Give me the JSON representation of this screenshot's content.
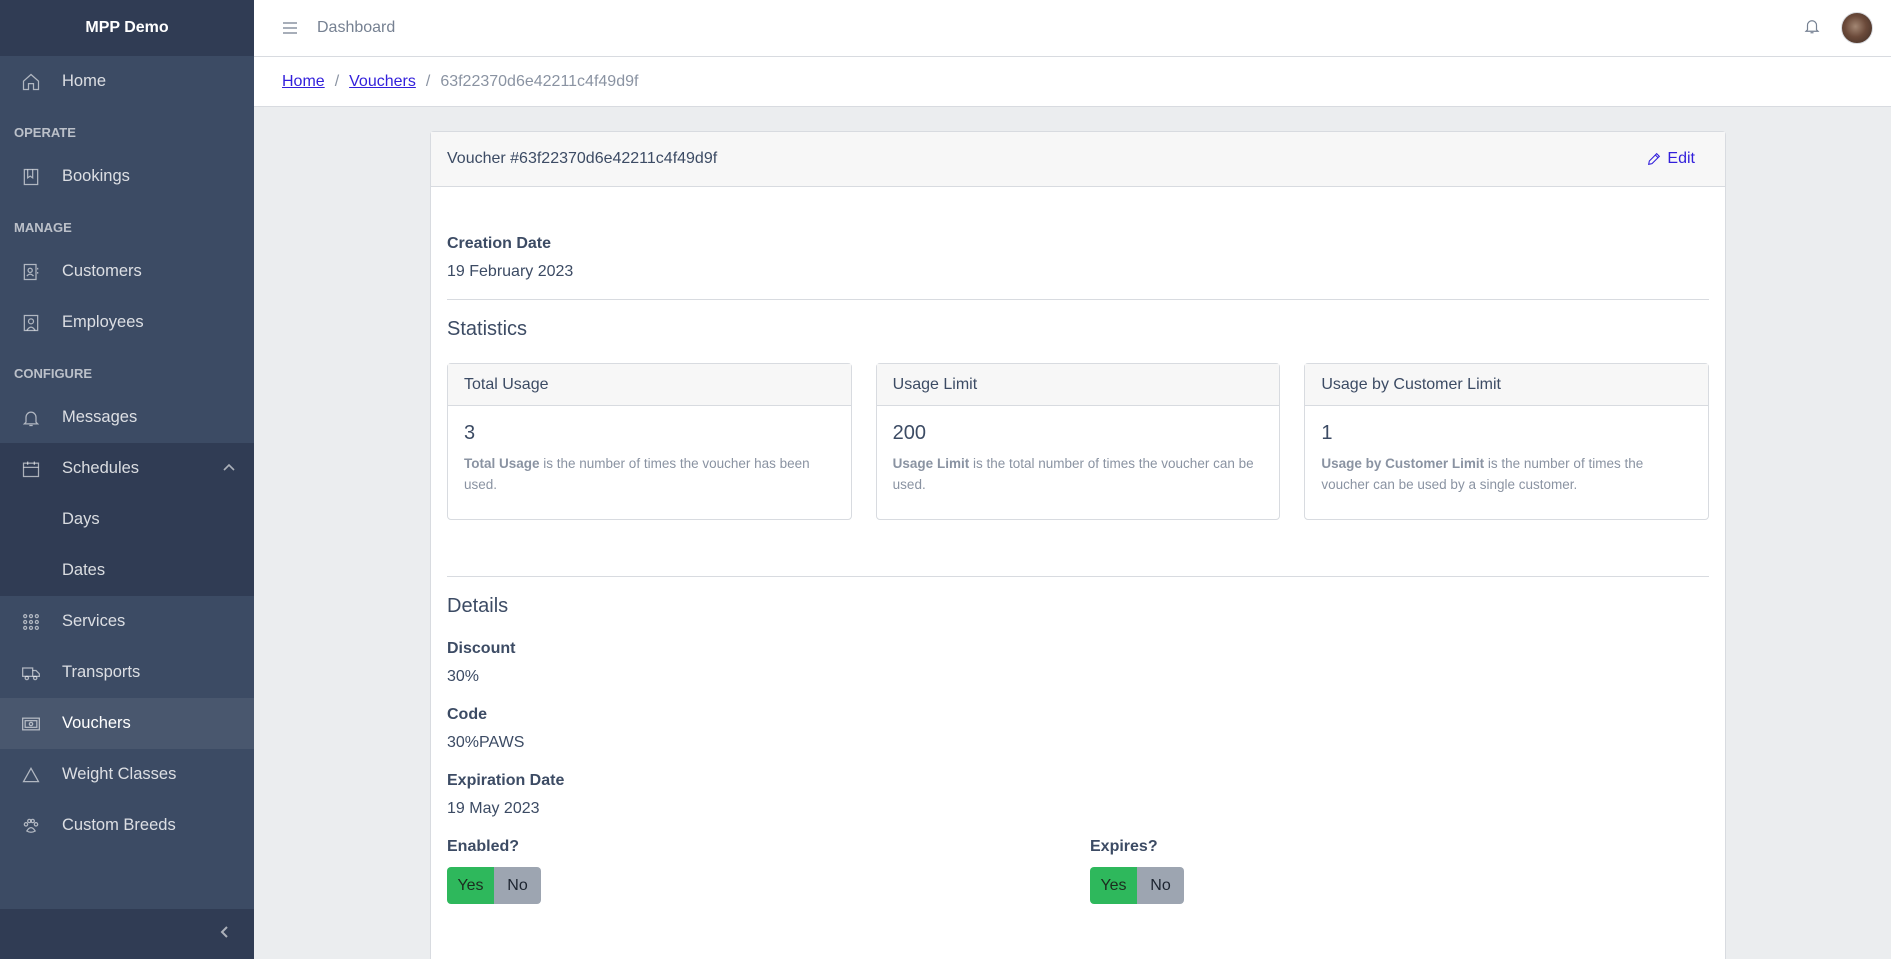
{
  "sidebar": {
    "brand": "MPP Demo",
    "home": "Home",
    "sections": {
      "operate": "OPERATE",
      "manage": "MANAGE",
      "configure": "CONFIGURE"
    },
    "items": {
      "bookings": "Bookings",
      "customers": "Customers",
      "employees": "Employees",
      "messages": "Messages",
      "schedules": "Schedules",
      "days": "Days",
      "dates": "Dates",
      "services": "Services",
      "transports": "Transports",
      "vouchers": "Vouchers",
      "weight_classes": "Weight Classes",
      "custom_breeds": "Custom Breeds"
    }
  },
  "header": {
    "title": "Dashboard"
  },
  "breadcrumb": {
    "home": "Home",
    "vouchers": "Vouchers",
    "current": "63f22370d6e42211c4f49d9f"
  },
  "voucher": {
    "title": "Voucher #63f22370d6e42211c4f49d9f",
    "edit_label": "Edit",
    "creation_date_label": "Creation Date",
    "creation_date": "19 February 2023",
    "statistics_title": "Statistics",
    "stats": [
      {
        "header": "Total Usage",
        "value": "3",
        "desc_bold": "Total Usage",
        "desc_rest": " is the number of times the voucher has been used."
      },
      {
        "header": "Usage Limit",
        "value": "200",
        "desc_bold": "Usage Limit",
        "desc_rest": " is the total number of times the voucher can be used."
      },
      {
        "header": "Usage by Customer Limit",
        "value": "1",
        "desc_bold": "Usage by Customer Limit",
        "desc_rest": " is the number of times the voucher can be used by a single customer."
      }
    ],
    "details_title": "Details",
    "discount_label": "Discount",
    "discount": "30%",
    "code_label": "Code",
    "code": "30%PAWS",
    "expiration_label": "Expiration Date",
    "expiration": "19 May 2023",
    "enabled_label": "Enabled?",
    "expires_label": "Expires?",
    "yes": "Yes",
    "no": "No"
  },
  "colors": {
    "sidebar": "#3c4b64",
    "link": "#321fdb",
    "success": "#2eb85c",
    "secondary": "#9da5b1"
  }
}
